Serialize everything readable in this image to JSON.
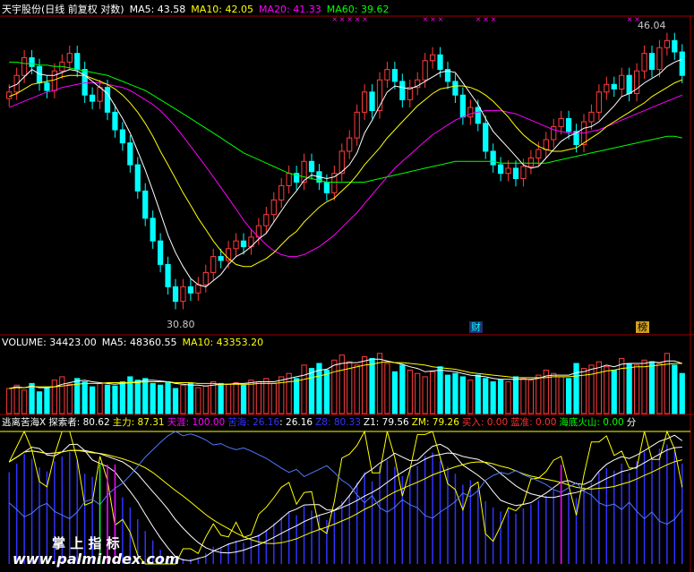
{
  "header": {
    "stock": "天宇股份(日线 前复权 对数)",
    "ma5": "MA5: 43.58",
    "ma10": "MA10: 42.05",
    "ma20": "MA20: 41.33",
    "ma60": "MA60: 39.62"
  },
  "price_labels": {
    "high": "46.04",
    "low": "30.80"
  },
  "badges": {
    "cai": "财",
    "bang": "榜"
  },
  "volume_header": {
    "volume": "VOLUME: 34423.00",
    "ma5": "MA5: 48360.55",
    "ma10": "MA10: 43353.20"
  },
  "indicator_header": {
    "name": "逃离苦海X",
    "tansuo": "探索者: 80.62",
    "zhuli": "主力: 87.31",
    "tianya": "天涯: 100.00",
    "kuhai": "苦海: 26.16",
    "v2616": ": 26.16",
    "z8": "Z8: 80.33",
    "z1": "Z1: 79.56",
    "zm": "ZM: 79.26",
    "buy": "买入: 0.00",
    "lanzhun": "蓝准: 0.00",
    "volcano": "海底火山: 0.00",
    "fen": "分"
  },
  "watermark": {
    "cn": "掌 上 指 标",
    "url": "www.palmindex.com"
  },
  "colors": {
    "up": "#ff3c3c",
    "down": "#00ffff",
    "ma5": "#ffffff",
    "ma10": "#ffff00",
    "ma20": "#ff00ff",
    "ma60": "#00ff00",
    "hist": "#3232ff"
  },
  "chart_data": {
    "type": "candlestick",
    "scale": "log",
    "close": [
      42.5,
      43.6,
      44.8,
      44.2,
      43.1,
      42.6,
      43.9,
      44.5,
      45.1,
      44.0,
      42.3,
      41.9,
      42.8,
      41.2,
      40.1,
      39.3,
      38.0,
      36.5,
      35.0,
      33.8,
      32.6,
      31.5,
      30.8,
      31.5,
      31.2,
      31.6,
      32.2,
      33.0,
      32.8,
      33.4,
      33.8,
      33.5,
      34.0,
      34.6,
      35.2,
      36.0,
      36.8,
      37.5,
      37.0,
      38.2,
      37.6,
      37.0,
      36.4,
      37.5,
      38.8,
      39.6,
      41.2,
      42.5,
      41.3,
      43.3,
      44.0,
      43.2,
      42.0,
      42.8,
      43.3,
      44.6,
      45.0,
      44.0,
      43.2,
      42.3,
      40.9,
      41.5,
      40.5,
      38.8,
      38.0,
      37.5,
      37.8,
      37.2,
      37.9,
      38.4,
      38.9,
      39.5,
      40.3,
      40.8,
      40.0,
      39.2,
      40.6,
      41.2,
      42.5,
      43.0,
      42.7,
      43.6,
      42.4,
      43.9,
      45.1,
      44.0,
      45.5,
      46.0,
      45.2,
      43.6
    ],
    "ma5": [
      42.8,
      43.0,
      43.5,
      44.0,
      43.7,
      43.6,
      43.6,
      43.8,
      44.0,
      43.9,
      43.6,
      43.2,
      42.8,
      42.4,
      41.6,
      40.8,
      39.9,
      38.8,
      37.7,
      36.5,
      35.3,
      34.1,
      33.2,
      32.5,
      31.9,
      31.6,
      31.5,
      31.8,
      32.1,
      32.6,
      33.0,
      33.2,
      33.5,
      33.9,
      34.2,
      34.8,
      35.4,
      36.0,
      36.5,
      37.1,
      37.4,
      37.3,
      37.2,
      37.3,
      37.6,
      38.0,
      38.7,
      39.9,
      40.7,
      41.6,
      42.5,
      42.9,
      42.8,
      42.7,
      42.9,
      43.2,
      43.5,
      43.8,
      43.9,
      43.8,
      43.1,
      42.4,
      41.7,
      40.8,
      40.0,
      39.5,
      39.0,
      38.5,
      38.0,
      37.8,
      37.9,
      38.4,
      38.9,
      39.4,
      39.7,
      39.9,
      40.2,
      40.3,
      40.6,
      41.1,
      41.6,
      42.2,
      42.4,
      42.7,
      43.1,
      43.4,
      43.7,
      44.2,
      44.5,
      44.7
    ],
    "ma10": [
      42.2,
      42.4,
      42.7,
      43.0,
      43.1,
      43.2,
      43.3,
      43.5,
      43.6,
      43.6,
      43.6,
      43.4,
      43.2,
      43.0,
      42.7,
      42.3,
      41.8,
      41.2,
      40.5,
      39.7,
      38.8,
      38.0,
      37.2,
      36.4,
      35.7,
      35.0,
      34.4,
      33.8,
      33.3,
      32.9,
      32.6,
      32.5,
      32.5,
      32.7,
      32.9,
      33.2,
      33.6,
      34.0,
      34.3,
      34.8,
      35.2,
      35.6,
      35.9,
      36.1,
      36.5,
      36.9,
      37.4,
      38.0,
      38.5,
      39.0,
      39.6,
      40.1,
      40.6,
      41.1,
      41.6,
      42.0,
      42.4,
      42.7,
      42.8,
      42.9,
      42.9,
      42.8,
      42.6,
      42.3,
      41.9,
      41.4,
      40.9,
      40.3,
      39.8,
      39.4,
      39.1,
      38.9,
      38.8,
      38.8,
      38.9,
      39.0,
      39.3,
      39.6,
      39.9,
      40.3,
      40.6,
      40.9,
      41.2,
      41.5,
      41.8,
      42.2,
      42.5,
      42.8,
      43.1,
      43.3
    ],
    "ma20": [
      41.5,
      41.7,
      41.9,
      42.1,
      42.3,
      42.5,
      42.6,
      42.8,
      42.9,
      43.0,
      43.1,
      43.1,
      43.1,
      43.0,
      42.9,
      42.8,
      42.6,
      42.3,
      42.0,
      41.7,
      41.3,
      40.8,
      40.3,
      39.7,
      39.1,
      38.5,
      37.9,
      37.3,
      36.7,
      36.1,
      35.5,
      34.9,
      34.4,
      34.0,
      33.6,
      33.3,
      33.1,
      33.0,
      33.0,
      33.1,
      33.3,
      33.5,
      33.8,
      34.1,
      34.5,
      34.9,
      35.3,
      35.8,
      36.3,
      36.8,
      37.3,
      37.8,
      38.2,
      38.6,
      39.0,
      39.4,
      39.8,
      40.1,
      40.4,
      40.7,
      40.9,
      41.1,
      41.2,
      41.3,
      41.3,
      41.3,
      41.2,
      41.1,
      40.9,
      40.7,
      40.5,
      40.3,
      40.1,
      40.0,
      39.9,
      39.9,
      39.9,
      40.0,
      40.1,
      40.3,
      40.5,
      40.7,
      40.9,
      41.1,
      41.3,
      41.5,
      41.7,
      41.9,
      42.1,
      42.3
    ],
    "ma60": [
      44.5,
      44.5,
      44.4,
      44.4,
      44.3,
      44.3,
      44.2,
      44.2,
      44.1,
      44.0,
      43.9,
      43.8,
      43.7,
      43.6,
      43.4,
      43.2,
      43.0,
      42.8,
      42.6,
      42.3,
      42.0,
      41.7,
      41.4,
      41.1,
      40.8,
      40.5,
      40.2,
      39.9,
      39.6,
      39.3,
      39.0,
      38.7,
      38.5,
      38.3,
      38.1,
      37.9,
      37.7,
      37.5,
      37.4,
      37.3,
      37.2,
      37.1,
      37.0,
      37.0,
      37.0,
      37.0,
      37.0,
      37.0,
      37.1,
      37.2,
      37.3,
      37.4,
      37.5,
      37.6,
      37.7,
      37.8,
      37.9,
      38.0,
      38.1,
      38.2,
      38.2,
      38.2,
      38.2,
      38.2,
      38.2,
      38.1,
      38.1,
      38.1,
      38.1,
      38.1,
      38.1,
      38.1,
      38.2,
      38.3,
      38.4,
      38.5,
      38.6,
      38.7,
      38.8,
      38.9,
      39.0,
      39.1,
      39.2,
      39.3,
      39.4,
      39.5,
      39.6,
      39.7,
      39.7,
      39.6
    ],
    "volume": [
      30,
      34,
      28,
      36,
      26,
      30,
      40,
      44,
      35,
      42,
      38,
      32,
      36,
      34,
      33,
      38,
      44,
      40,
      42,
      36,
      34,
      38,
      30,
      34,
      36,
      31,
      33,
      38,
      36,
      35,
      37,
      34,
      40,
      38,
      42,
      36,
      44,
      48,
      42,
      58,
      54,
      60,
      52,
      64,
      70,
      62,
      58,
      68,
      66,
      72,
      60,
      50,
      58,
      52,
      48,
      44,
      50,
      56,
      46,
      48,
      44,
      40,
      46,
      42,
      38,
      40,
      38,
      44,
      42,
      40,
      46,
      52,
      48,
      44,
      42,
      60,
      54,
      58,
      62,
      56,
      52,
      66,
      60,
      58,
      64,
      62,
      60,
      72,
      58,
      48
    ],
    "vol_ma5": [
      30,
      32,
      31,
      33,
      31,
      31,
      32,
      35,
      37,
      39,
      40,
      38,
      37,
      36,
      35,
      36,
      37,
      38,
      40,
      40,
      39,
      38,
      36,
      35,
      34,
      34,
      33,
      34,
      35,
      35,
      36,
      36,
      37,
      38,
      38,
      38,
      40,
      42,
      44,
      46,
      49,
      52,
      53,
      58,
      60,
      61,
      61,
      63,
      65,
      65,
      63,
      61,
      59,
      56,
      54,
      50,
      51,
      52,
      51,
      50,
      48,
      46,
      45,
      44,
      42,
      41,
      41,
      41,
      41,
      41,
      42,
      45,
      46,
      46,
      46,
      49,
      50,
      53,
      55,
      58,
      56,
      59,
      60,
      60,
      60,
      62,
      61,
      63,
      63,
      60
    ],
    "vol_ma10": [
      30,
      31,
      31,
      32,
      32,
      32,
      32,
      33,
      34,
      35,
      36,
      36,
      36,
      37,
      37,
      37,
      37,
      37,
      38,
      38,
      38,
      38,
      37,
      37,
      37,
      36,
      36,
      36,
      35,
      35,
      35,
      35,
      35,
      36,
      36,
      36,
      37,
      38,
      39,
      41,
      43,
      45,
      47,
      50,
      52,
      54,
      56,
      58,
      59,
      61,
      62,
      61,
      61,
      60,
      59,
      58,
      56,
      55,
      54,
      53,
      51,
      49,
      48,
      47,
      46,
      45,
      44,
      43,
      43,
      43,
      43,
      43,
      44,
      44,
      44,
      45,
      46,
      47,
      49,
      51,
      52,
      54,
      55,
      56,
      56,
      57,
      58,
      59,
      60,
      60
    ],
    "indicator": {
      "name": "逃离苦海X",
      "series": [
        {
          "name": "探索者",
          "last": 80.62
        },
        {
          "name": "主力",
          "last": 87.31
        },
        {
          "name": "天涯",
          "last": 100.0
        },
        {
          "name": "苦海",
          "last": 26.16
        },
        {
          "name": "Z8",
          "last": 80.33
        },
        {
          "name": "Z1",
          "last": 79.56
        },
        {
          "name": "ZM",
          "last": 79.26
        }
      ]
    }
  }
}
